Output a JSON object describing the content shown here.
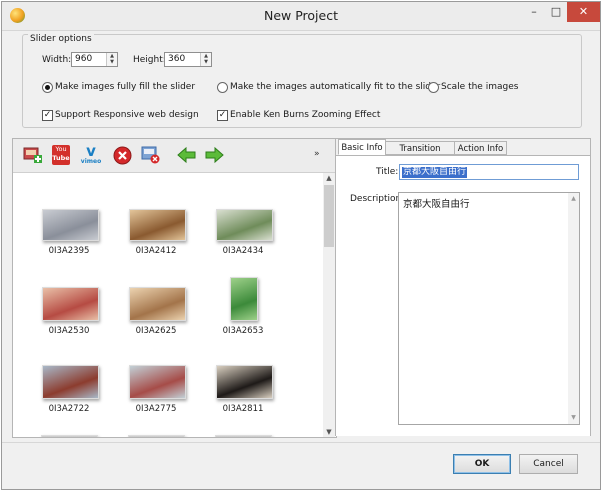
{
  "window": {
    "title": "New Project",
    "min_glyph": "–",
    "max_glyph": "□",
    "close_glyph": "✕"
  },
  "slider_options": {
    "legend": "Slider options",
    "width_label": "Width:",
    "width_value": "960",
    "height_label": "Height:",
    "height_value": "360",
    "fill_options": [
      {
        "label": "Make images fully fill the slider",
        "selected": true
      },
      {
        "label": "Make the images automatically fit to the slider",
        "selected": false
      },
      {
        "label": "Scale the images",
        "selected": false
      }
    ],
    "responsive_label": "Support Responsive web design",
    "responsive_checked": true,
    "ken_burns_label": "Enable Ken Burns Zooming Effect",
    "ken_burns_checked": true
  },
  "toolbar": {
    "youtube_line1": "You",
    "youtube_line2": "Tube",
    "vimeo_label": "vimeo",
    "more_glyph": "»"
  },
  "images": [
    {
      "name": "0I3A2395",
      "colors": [
        "#8a8f9a",
        "#c9ccd2"
      ]
    },
    {
      "name": "0I3A2412",
      "colors": [
        "#8a5a30",
        "#e3c59a"
      ]
    },
    {
      "name": "0I3A2434",
      "colors": [
        "#6f8c5a",
        "#d9dfd0"
      ]
    },
    {
      "name": "0I3A2530",
      "colors": [
        "#b64b43",
        "#e9c0a8"
      ]
    },
    {
      "name": "0I3A2625",
      "colors": [
        "#a3744a",
        "#ecd3b0"
      ]
    },
    {
      "name": "0I3A2653",
      "colors": [
        "#3c8a3a",
        "#9ed18a"
      ]
    },
    {
      "name": "0I3A2722",
      "colors": [
        "#8c3c2e",
        "#a8b8c8"
      ]
    },
    {
      "name": "0I3A2775",
      "colors": [
        "#a64c48",
        "#c2d0d6"
      ]
    },
    {
      "name": "0I3A2811",
      "colors": [
        "#1e1a18",
        "#d9cfc0"
      ]
    }
  ],
  "details": {
    "tabs": [
      "Basic Info",
      "Transition Effect",
      "Action Info"
    ],
    "active_tab": "Basic Info",
    "title_label": "Title:",
    "title_value": "京都大阪自由行",
    "description_label": "Description:",
    "description_value": "京都大阪自由行"
  },
  "buttons": {
    "ok": "OK",
    "cancel": "Cancel"
  }
}
